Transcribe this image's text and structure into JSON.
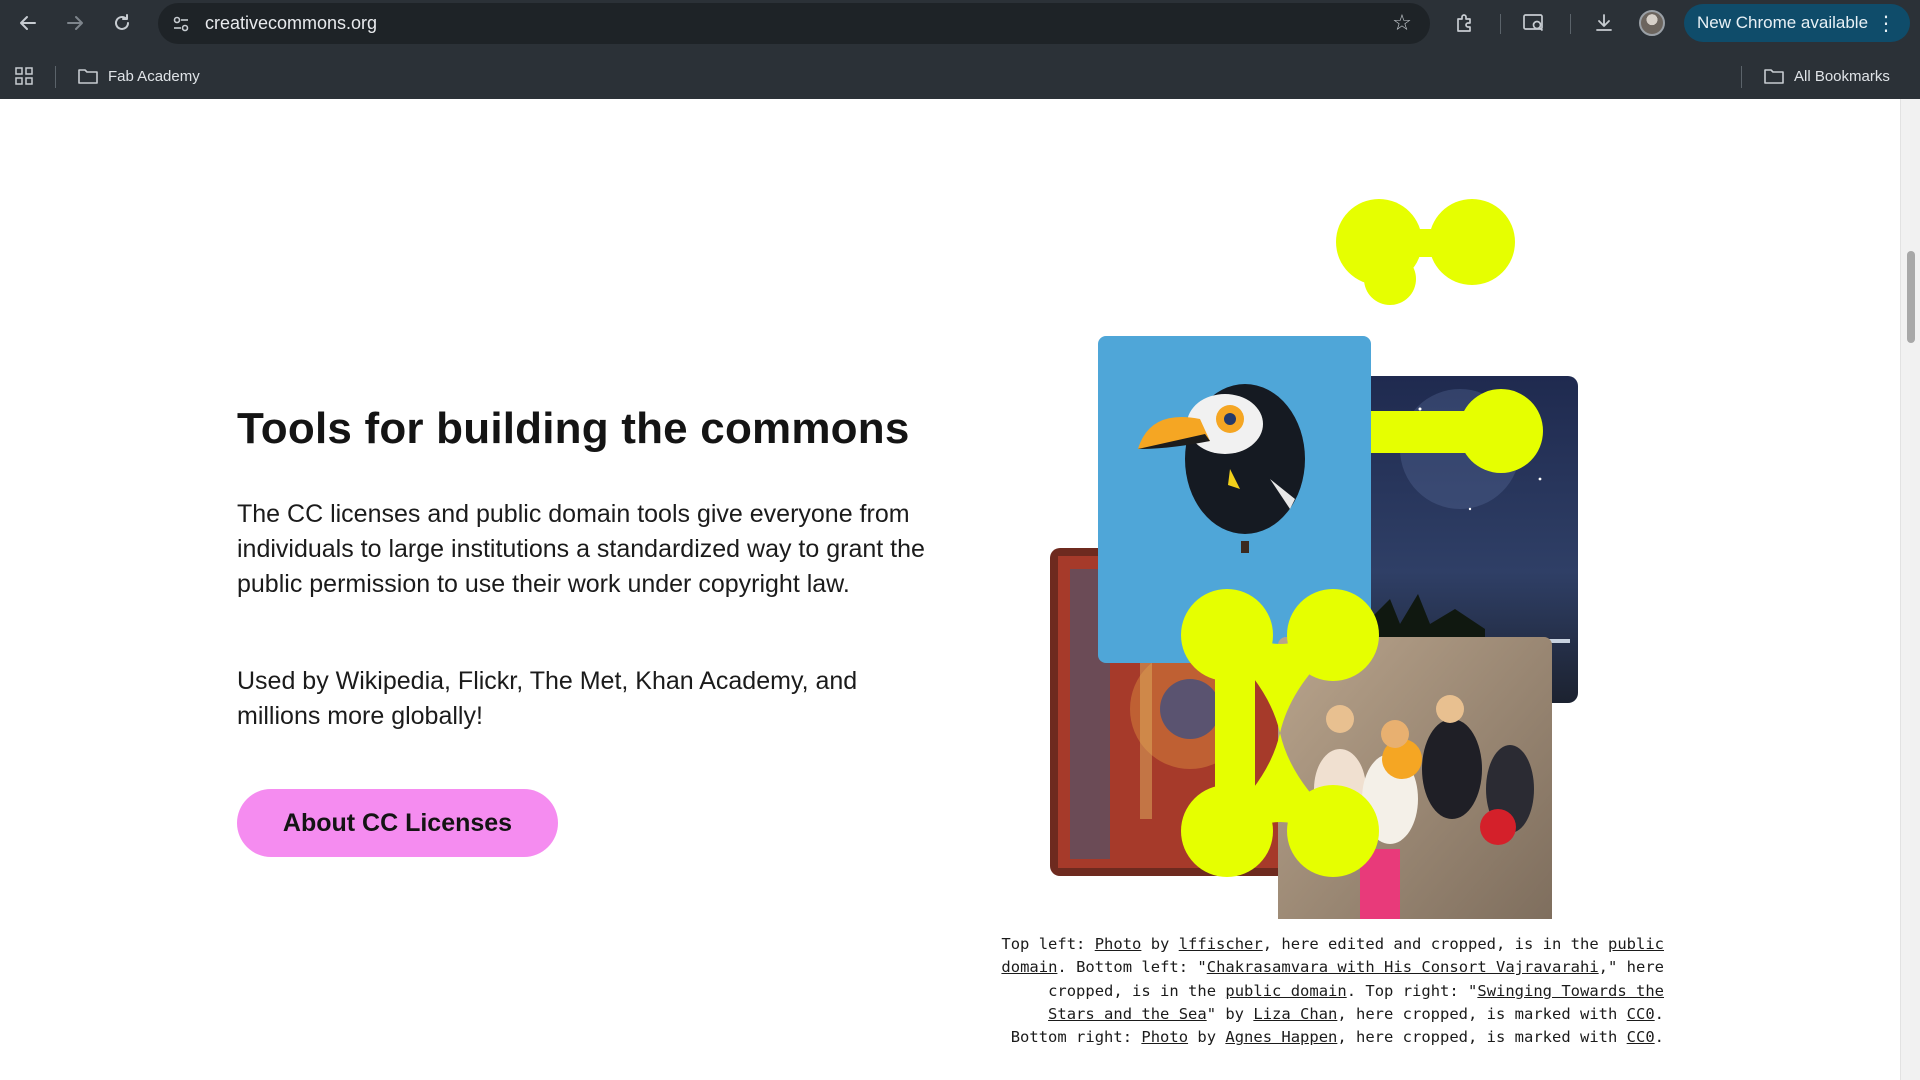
{
  "browser": {
    "url": "creativecommons.org",
    "update_label": "New Chrome available",
    "bookmarks": [
      {
        "label": "Fab Academy"
      },
      {
        "label": "All Bookmarks"
      }
    ],
    "icons": [
      "back-arrow-icon",
      "forward-arrow-icon",
      "reload-icon",
      "site-info-icon",
      "star-icon",
      "extensions-icon",
      "media-controls-icon",
      "download-icon",
      "profile-avatar",
      "more-vert-icon",
      "apps-grid-icon",
      "folder-icon"
    ]
  },
  "hero": {
    "title": "Tools for building the commons",
    "paragraph1": "The CC licenses and public domain tools give everyone from individuals to large institutions a standardized way to grant the public permission to use their work under copyright law.",
    "paragraph2": "Used by Wikipedia, Flickr, The Met, Khan Academy, and millions more globally!",
    "button_label": "About CC Licenses"
  },
  "credits": {
    "t1": "Top left: ",
    "l1": "Photo",
    "t2": " by ",
    "l2": "lffischer",
    "t3": ", here edited and cropped, is in the ",
    "l3": "public domain",
    "t4": ". Bottom left: \"",
    "l4": "Chakrasamvara with His Consort Vajravarahi",
    "t5": ",\" here cropped, is in the ",
    "l5": "public domain",
    "t6": ". Top right: \"",
    "l6": "Swinging Towards the Stars and the Sea",
    "t7": "\" by ",
    "l7": "Liza Chan",
    "t8": ", here cropped, is marked with ",
    "l8": "CC0",
    "t9": ". Bottom right: ",
    "l9": "Photo",
    "t10": " by ",
    "l10": "Agnes Happen",
    "t11": ", here cropped, is marked with ",
    "l11": "CC0",
    "t12": "."
  },
  "colors": {
    "accent_lime": "#e6ff00",
    "button_pink": "#f58cf0",
    "chrome_bg": "#2b3137",
    "update_pill": "#0f4c6a"
  }
}
